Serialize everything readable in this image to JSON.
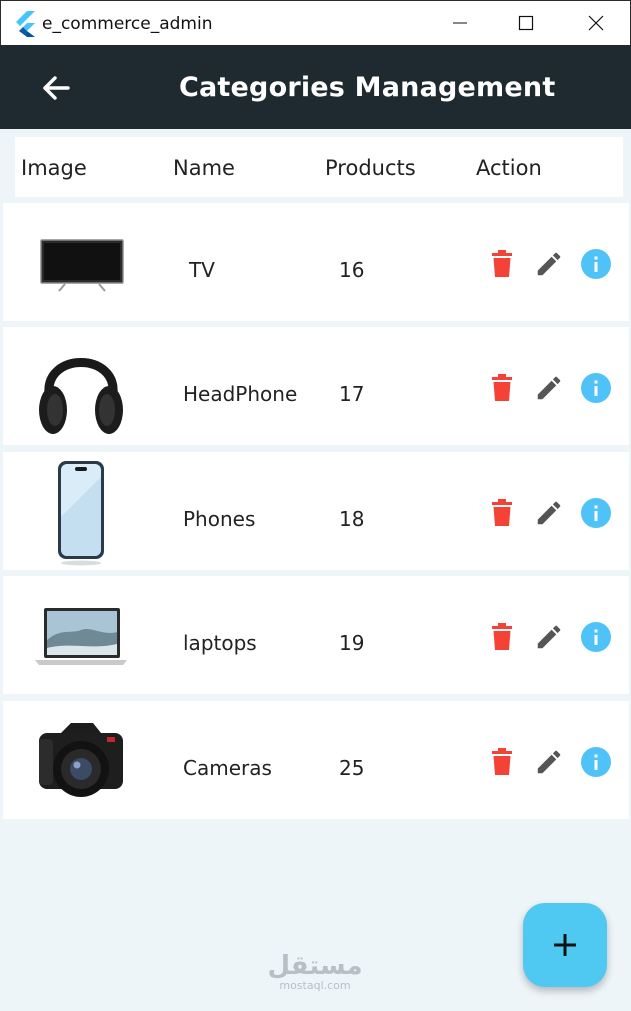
{
  "window": {
    "title": "e_commerce_admin"
  },
  "appbar": {
    "title": "Categories Management"
  },
  "table": {
    "headers": {
      "image": "Image",
      "name": "Name",
      "products": "Products",
      "action": "Action"
    },
    "rows": [
      {
        "name": "TV",
        "products": "16",
        "image_icon": "tv-image"
      },
      {
        "name": "HeadPhone",
        "products": "17",
        "image_icon": "headphone-image"
      },
      {
        "name": "Phones",
        "products": "18",
        "image_icon": "phone-image"
      },
      {
        "name": "laptops",
        "products": "19",
        "image_icon": "laptop-image"
      },
      {
        "name": "Cameras",
        "products": "25",
        "image_icon": "camera-image"
      }
    ]
  },
  "icons": {
    "delete": "trash-icon",
    "edit": "pencil-icon",
    "info": "info-icon",
    "back": "arrow-left-icon",
    "add": "plus-icon"
  },
  "colors": {
    "appbar": "#1f2a30",
    "background": "#eef5f9",
    "delete": "#f44336",
    "edit": "#555555",
    "info": "#4fc3f7",
    "fab": "#4fc8f2"
  },
  "watermark": {
    "arabic": "مستقل",
    "latin": "mostaql.com"
  }
}
